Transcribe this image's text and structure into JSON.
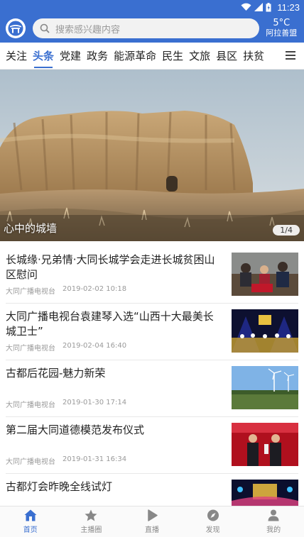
{
  "status_bar": {
    "time": "11:23"
  },
  "header": {
    "search_placeholder": "搜索感兴趣内容",
    "weather_temp": "5°C",
    "weather_city": "阿拉善盟"
  },
  "tabs": [
    {
      "label": "关注"
    },
    {
      "label": "头条"
    },
    {
      "label": "党建"
    },
    {
      "label": "政务"
    },
    {
      "label": "能源革命"
    },
    {
      "label": "民生"
    },
    {
      "label": "文旅"
    },
    {
      "label": "县区"
    },
    {
      "label": "扶贫"
    }
  ],
  "banner": {
    "caption": "心中的城墙",
    "counter": "1/4"
  },
  "news": [
    {
      "title": "长城缘·兄弟情·大同长城学会走进长城贫困山区慰问",
      "source": "大同广播电视台",
      "time": "2019-02-02 10:18"
    },
    {
      "title": "大同广播电视台袁建琴入选“山西十大最美长城卫士”",
      "source": "大同广播电视台",
      "time": "2019-02-04 16:40"
    },
    {
      "title": "古都后花园-魅力新荣",
      "source": "大同广播电视台",
      "time": "2019-01-30 17:14"
    },
    {
      "title": "第二届大同道德模范发布仪式",
      "source": "大同广播电视台",
      "time": "2019-01-31 16:34"
    },
    {
      "title": "古都灯会昨晚全线试灯",
      "source": "",
      "time": ""
    }
  ],
  "bottom_nav": [
    {
      "label": "首页",
      "icon": "home-icon"
    },
    {
      "label": "主播圈",
      "icon": "star-icon"
    },
    {
      "label": "直播",
      "icon": "play-icon"
    },
    {
      "label": "发现",
      "icon": "compass-icon"
    },
    {
      "label": "我的",
      "icon": "user-icon"
    }
  ],
  "colors": {
    "accent": "#3a6fd0"
  }
}
